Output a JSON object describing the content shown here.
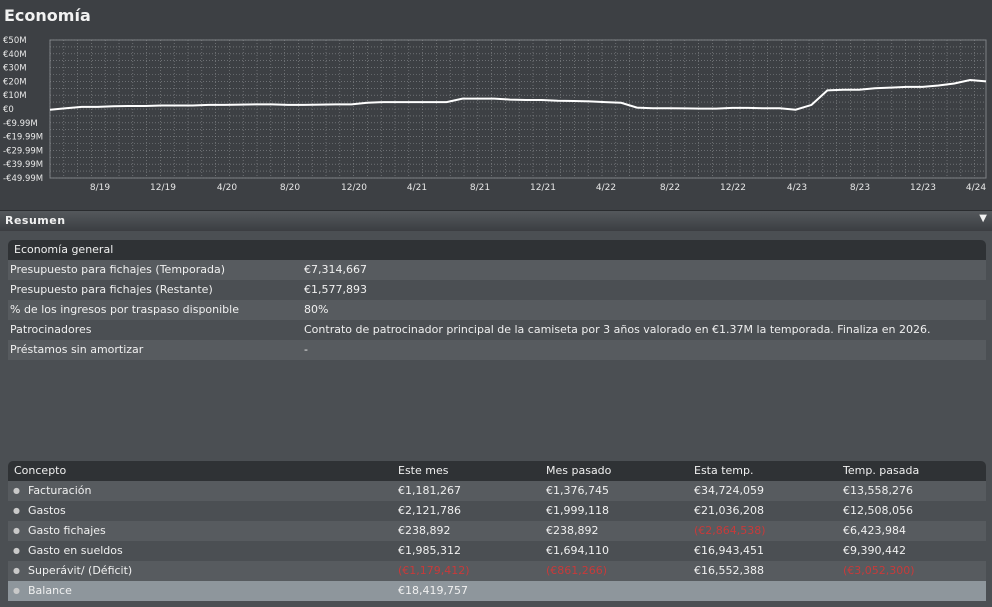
{
  "title": "Economía",
  "chart_data": {
    "type": "line",
    "y_ticks": [
      "€50M",
      "€40M",
      "€30M",
      "€20M",
      "€10M",
      "€0",
      "-€9.99M",
      "-€19.99M",
      "-€29.99M",
      "-€39.99M",
      "-€49.99M"
    ],
    "x_ticks": [
      "8/19",
      "12/19",
      "4/20",
      "8/20",
      "12/20",
      "4/21",
      "8/21",
      "12/21",
      "4/22",
      "8/22",
      "12/22",
      "4/23",
      "8/23",
      "12/23",
      "4/24"
    ],
    "ylim": [
      -50,
      50
    ],
    "ylabel_unit": "€M",
    "grid": true,
    "values": [
      -0.5,
      0.5,
      1.5,
      1.5,
      2.0,
      2.2,
      2.2,
      2.5,
      2.5,
      2.5,
      3.0,
      3.0,
      3.2,
      3.3,
      3.3,
      3.0,
      3.0,
      3.2,
      3.3,
      3.3,
      4.5,
      5.0,
      5.0,
      5.0,
      5.0,
      5.0,
      7.5,
      7.5,
      7.5,
      6.8,
      6.5,
      6.5,
      6.0,
      5.8,
      5.5,
      5.0,
      4.5,
      1.0,
      0.5,
      0.5,
      0.4,
      0.3,
      0.3,
      0.8,
      0.8,
      0.5,
      0.5,
      -0.5,
      3.0,
      13.5,
      14.0,
      14.0,
      15.0,
      15.5,
      16.0,
      16.0,
      17.0,
      18.5,
      21.0,
      20.0
    ]
  },
  "section": {
    "title": "Resumen",
    "arrow_icon": "triangle-down"
  },
  "general": {
    "header": "Economía general",
    "rows": [
      {
        "label": "Presupuesto para fichajes (Temporada)",
        "value": "€7,314,667"
      },
      {
        "label": "Presupuesto para fichajes (Restante)",
        "value": "€1,577,893"
      },
      {
        "label": "% de los ingresos por traspaso disponible",
        "value": "80%"
      },
      {
        "label": "Patrocinadores",
        "value": "Contrato de patrocinador principal de la camiseta por 3 años valorado en €1.37M la temporada. Finaliza en 2026."
      },
      {
        "label": "Préstamos sin amortizar",
        "value": "-"
      }
    ]
  },
  "finance": {
    "headers": [
      "Concepto",
      "Este mes",
      "Mes pasado",
      "Esta temp.",
      "Temp. pasada"
    ],
    "rows": [
      {
        "concept": "Facturación",
        "cells": [
          "€1,181,267",
          "€1,376,745",
          "€34,724,059",
          "€13,558,276"
        ]
      },
      {
        "concept": "Gastos",
        "cells": [
          "€2,121,786",
          "€1,999,118",
          "€21,036,208",
          "€12,508,056"
        ]
      },
      {
        "concept": "Gasto fichajes",
        "cells": [
          "€238,892",
          "€238,892",
          "(€2,864,538)",
          "€6,423,984"
        ]
      },
      {
        "concept": "Gasto en sueldos",
        "cells": [
          "€1,985,312",
          "€1,694,110",
          "€16,943,451",
          "€9,390,442"
        ]
      },
      {
        "concept": "Superávit/ (Déficit)",
        "cells": [
          "(€1,179,412)",
          "(€861,266)",
          "€16,552,388",
          "(€3,052,300)"
        ]
      },
      {
        "concept": "Balance",
        "cells": [
          "€18,419,757",
          "",
          "",
          ""
        ]
      }
    ],
    "negative_color": "#c83a3a"
  }
}
